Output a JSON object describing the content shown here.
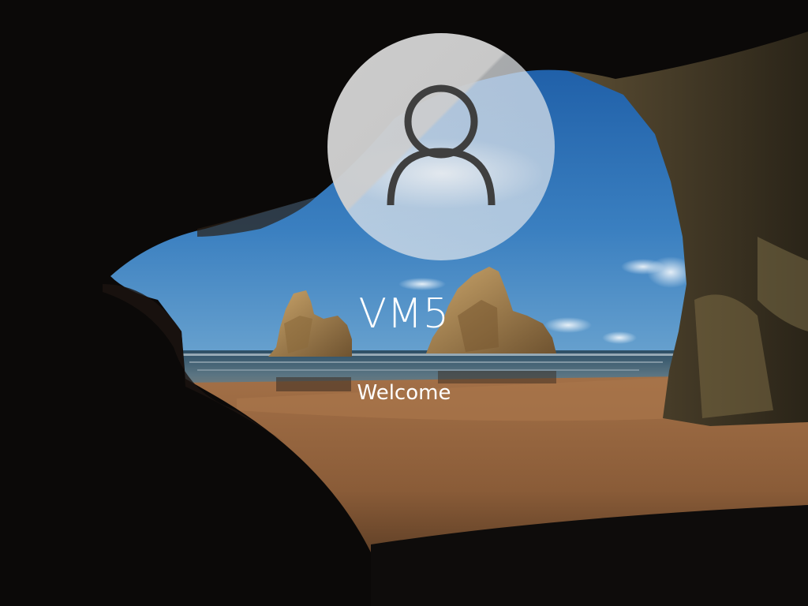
{
  "lockscreen": {
    "user_name": "VM5",
    "status_text": "Welcome",
    "avatar_icon": "user-silhouette-icon"
  },
  "colors": {
    "text": "#ffffff",
    "sky": "#3a78b8",
    "sand": "#9a6a40",
    "cave": "#0b0908"
  }
}
